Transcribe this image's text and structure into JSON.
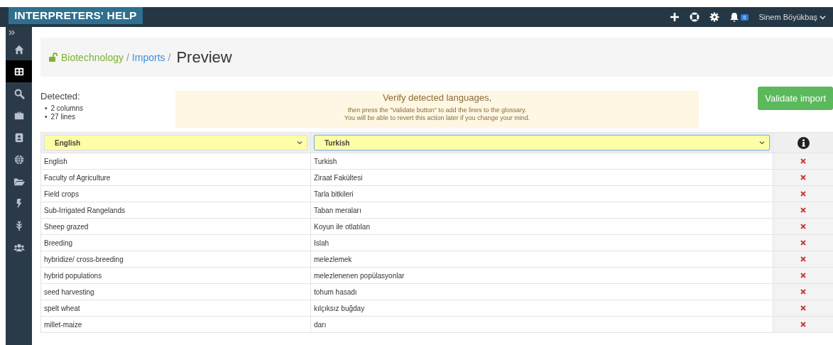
{
  "app": {
    "title": "INTERPRETERS' HELP"
  },
  "topbar": {
    "notifications": "0",
    "user": "Sinem Böyükbaş"
  },
  "sidebar": {
    "items": [
      {
        "kind": "home",
        "selected": false
      },
      {
        "kind": "grid",
        "selected": true
      },
      {
        "kind": "search",
        "selected": false
      },
      {
        "kind": "briefcase",
        "selected": false
      },
      {
        "kind": "contacts",
        "selected": false
      },
      {
        "kind": "globe",
        "selected": false
      },
      {
        "kind": "folder",
        "selected": false
      },
      {
        "kind": "bolt",
        "selected": false
      },
      {
        "kind": "plant",
        "selected": false
      },
      {
        "kind": "users",
        "selected": false
      }
    ]
  },
  "breadcrumb": {
    "items": [
      "Biotechnology",
      "Imports"
    ],
    "separator": "/",
    "current": "Preview"
  },
  "detected": {
    "title": "Detected:",
    "bullet": "•",
    "items": [
      "2 columns",
      "27 lines"
    ]
  },
  "notice": {
    "title": "Verify detected languages,",
    "lines": [
      "then press the \"Validate button\" to add the lines to the glossary.",
      "You will be able to revert this action later if you change your mind."
    ]
  },
  "validate_button": "Validate import",
  "table": {
    "columns": [
      {
        "language": "English",
        "focused": false
      },
      {
        "language": "Turkish",
        "focused": true
      }
    ],
    "rows": [
      [
        "English",
        "Turkish"
      ],
      [
        "Faculty of Agriculture",
        "Ziraat Fakültesi"
      ],
      [
        "Field crops",
        "Tarla bitkileri"
      ],
      [
        "Sub-Irrigated Rangelands",
        "Taban meraları"
      ],
      [
        "Sheep grazed",
        "Koyun ile otlatılan"
      ],
      [
        "Breeding",
        "Islah"
      ],
      [
        "hybridize/ cross-breeding",
        "melezlemek"
      ],
      [
        "hybrid populations",
        "melezlenenen popülasyonlar"
      ],
      [
        "seed harvesting",
        "tohum hasadı"
      ],
      [
        "spelt wheat",
        "kılçıksız buğday"
      ],
      [
        "millet-maize",
        "darı"
      ]
    ]
  }
}
